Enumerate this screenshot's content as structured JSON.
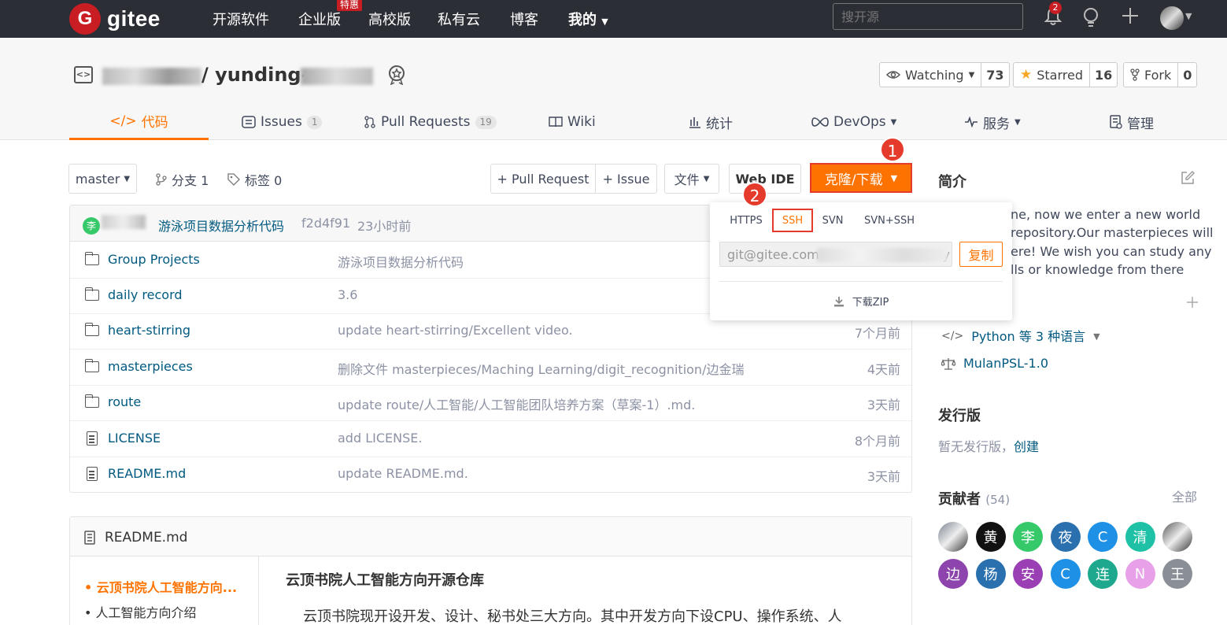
{
  "topnav": {
    "brand": "gitee",
    "brand_mark": "G",
    "items": [
      "开源软件",
      "企业版",
      "高校版",
      "私有云",
      "博客",
      "我的"
    ],
    "enterprise_badge": "特惠",
    "search_placeholder": "搜开源",
    "notification_count": "2"
  },
  "repo": {
    "title_suffix": "/ yunding-",
    "watch_label": "Watching",
    "watch_count": "73",
    "star_label": "Starred",
    "star_count": "16",
    "fork_label": "Fork",
    "fork_count": "0"
  },
  "tabs": [
    {
      "label": "代码",
      "icon": "code-icon"
    },
    {
      "label": "Issues",
      "count": "1"
    },
    {
      "label": "Pull Requests",
      "count": "19"
    },
    {
      "label": "Wiki"
    },
    {
      "label": "统计"
    },
    {
      "label": "DevOps"
    },
    {
      "label": "服务"
    },
    {
      "label": "管理"
    }
  ],
  "toolbar": {
    "branch": "master",
    "branches_label": "分支 1",
    "tags_label": "标签 0",
    "pull_request": "+ Pull Request",
    "issue": "+ Issue",
    "file": "文件",
    "web_ide": "Web IDE",
    "clone": "克隆/下载",
    "step1": "1",
    "step2": "2"
  },
  "commit": {
    "avatar_letter": "李",
    "message": "游泳项目数据分析代码",
    "hash": "f2d4f91",
    "time": "23小时前"
  },
  "files": [
    {
      "type": "folder",
      "name": "Group Projects",
      "message": "游泳项目数据分析代码",
      "time": ""
    },
    {
      "type": "folder",
      "name": "daily record",
      "message": "3.6",
      "time": ""
    },
    {
      "type": "folder",
      "name": "heart-stirring",
      "message": "update heart-stirring/Excellent video.",
      "time": "7个月前"
    },
    {
      "type": "folder",
      "name": "masterpieces",
      "message": "删除文件 masterpieces/Maching Learning/digit_recognition/边金瑞",
      "time": "4天前"
    },
    {
      "type": "folder",
      "name": "route",
      "message": "update route/人工智能/人工智能团队培养方案（草案-1）.md.",
      "time": "3天前"
    },
    {
      "type": "file",
      "name": "LICENSE",
      "message": "add LICENSE.",
      "time": "8个月前"
    },
    {
      "type": "file",
      "name": "README.md",
      "message": "update README.md.",
      "time": "3天前"
    }
  ],
  "clone_popup": {
    "protocols": [
      "HTTPS",
      "SSH",
      "SVN",
      "SVN+SSH"
    ],
    "active": "SSH",
    "url": "git@gitee.com:",
    "url_tail": "y",
    "copy": "复制",
    "download_zip": "下载ZIP"
  },
  "readme": {
    "filename": "README.md",
    "toc": [
      "云顶书院人工智能方向...",
      "人工智能方向介绍"
    ],
    "heading": "云顶书院人工智能方向开源仓库",
    "paragraph": "云顶书院现开设开发、设计、秘书处三大方向。其中开发方向下设CPU、操作系统、人"
  },
  "sidebar": {
    "intro_title": "简介",
    "intro_lines": [
      "ne, now we enter a new world",
      "repository.Our masterpieces will",
      "ere!  We wish you can study any",
      "lls or knowledge from there"
    ],
    "language": "Python 等 3 种语言",
    "license": "MulanPSL-1.0",
    "releases_title": "发行版",
    "releases_text": "暂无发行版，",
    "releases_create": "创建",
    "contributors_title": "贡献者",
    "contributors_count": "(54)",
    "contributors_all": "全部",
    "contributors": [
      {
        "letter": "",
        "color": "#7a8290"
      },
      {
        "letter": "黄",
        "color": "#111111"
      },
      {
        "letter": "李",
        "color": "#35c96a"
      },
      {
        "letter": "夜",
        "color": "#2a6fae"
      },
      {
        "letter": "C",
        "color": "#1e90e6"
      },
      {
        "letter": "清",
        "color": "#1ec1a5"
      },
      {
        "letter": "",
        "color": "#555555"
      },
      {
        "letter": "边",
        "color": "#8e44ad"
      },
      {
        "letter": "杨",
        "color": "#2a6fae"
      },
      {
        "letter": "安",
        "color": "#9b3fb5"
      },
      {
        "letter": "C",
        "color": "#1e90e6"
      },
      {
        "letter": "连",
        "color": "#1ea88e"
      },
      {
        "letter": "N",
        "color": "#e8a0e8"
      },
      {
        "letter": "王",
        "color": "#8a8f97"
      }
    ]
  },
  "colors": {
    "accent": "#fe7300",
    "brand": "#c71d23",
    "link": "#005980",
    "highlight_box": "#e53b2c"
  }
}
